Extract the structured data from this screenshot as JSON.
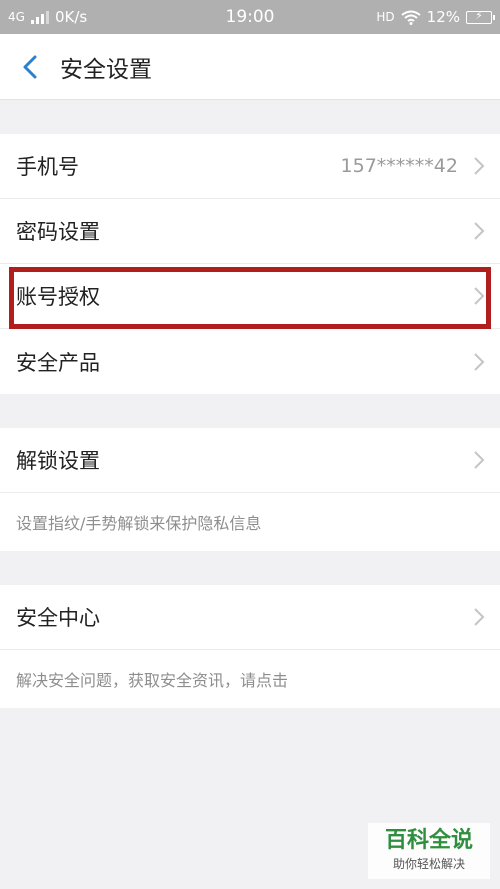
{
  "status_bar": {
    "network": "4G",
    "speed": "0K/s",
    "time": "19:00",
    "hd": "HD",
    "battery": "12%"
  },
  "nav": {
    "title": "安全设置"
  },
  "group1": {
    "phone_label": "手机号",
    "phone_value": "157******42",
    "password_label": "密码设置",
    "auth_label": "账号授权",
    "products_label": "安全产品"
  },
  "group2": {
    "unlock_label": "解锁设置",
    "unlock_desc": "设置指纹/手势解锁来保护隐私信息"
  },
  "group3": {
    "center_label": "安全中心",
    "center_desc": "解决安全问题，获取安全资讯，请点击"
  },
  "watermark": {
    "main": "百科全说",
    "sub": "助你轻松解决"
  },
  "colors": {
    "accent": "#2a7fcf",
    "highlight": "#b01e1e",
    "watermark": "#2f8f3f"
  }
}
